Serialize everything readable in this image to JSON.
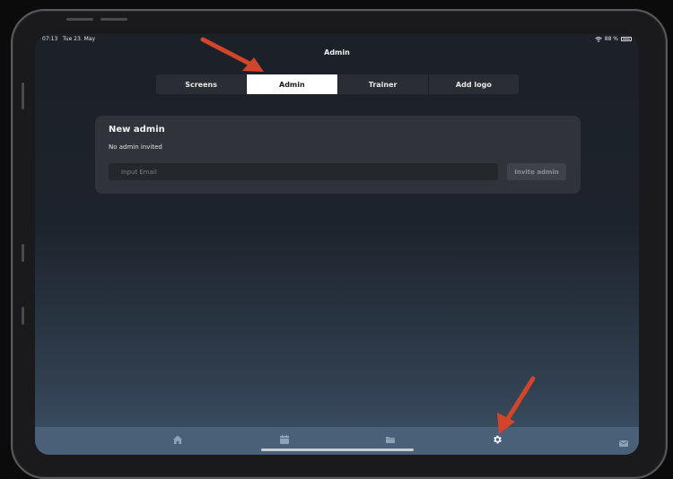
{
  "status_bar": {
    "time": "07:13",
    "date": "Tue 23. May",
    "battery": "88 %"
  },
  "header": {
    "title": "Admin"
  },
  "tabs": [
    {
      "label": "Screens",
      "active": false
    },
    {
      "label": "Admin",
      "active": true
    },
    {
      "label": "Trainer",
      "active": false
    },
    {
      "label": "Add logo",
      "active": false
    }
  ],
  "new_admin": {
    "title": "New admin",
    "status": "No admin invited",
    "email_placeholder": "Input Email",
    "invite_label": "Invite admin"
  },
  "tab_bar": {
    "icons": [
      "home-icon",
      "calendar-icon",
      "folder-icon",
      "gear-icon"
    ],
    "active": "gear-icon"
  },
  "colors": {
    "annotation_arrow": "#d2452b",
    "tab_bar": "#4a6079",
    "card": "#30343a",
    "active_tab": "#ffffff"
  }
}
